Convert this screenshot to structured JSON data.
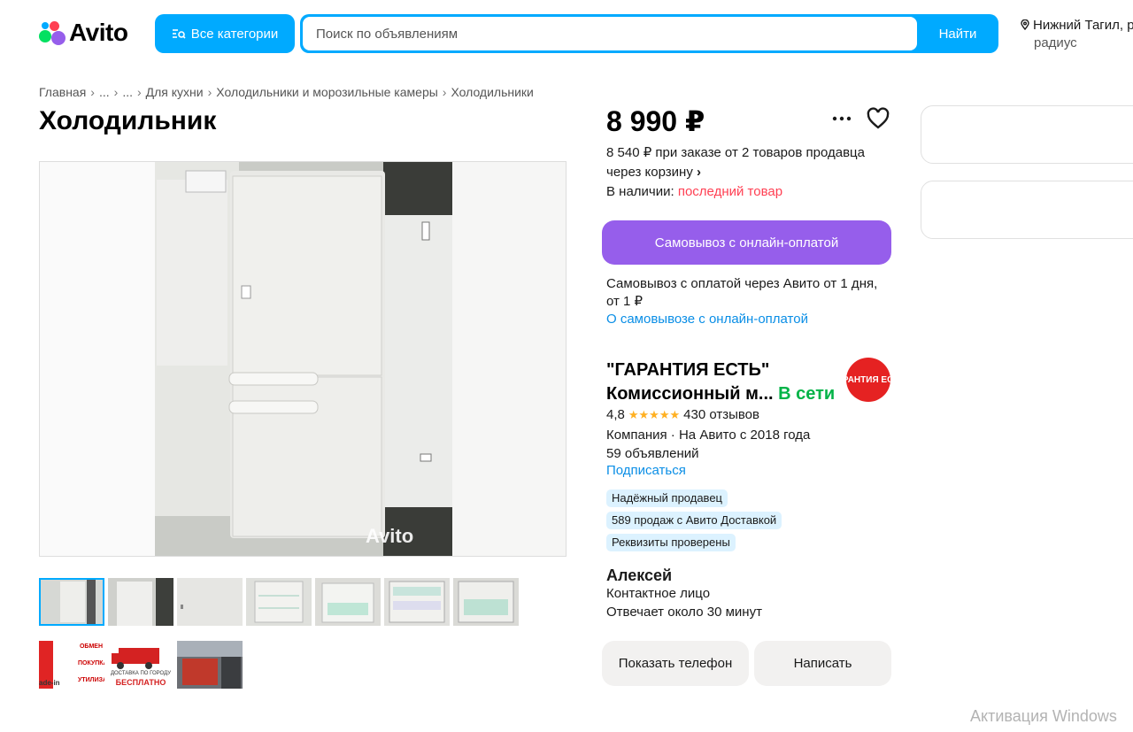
{
  "header": {
    "logo_text": "Avito",
    "categories_label": "Все категории",
    "search_placeholder": "Поиск по объявлениям",
    "search_button": "Найти",
    "location_line1": "Нижний Тагил, р",
    "location_line2": "радиус"
  },
  "breadcrumb": [
    "Главная",
    "...",
    "...",
    "Для кухни",
    "Холодильники и морозильные камеры",
    "Холодильники"
  ],
  "listing": {
    "title": "Холодильник",
    "photo_watermark": "Avito",
    "price": "8 990 ₽",
    "price_alt": "8 540 ₽ при заказе от 2 товаров продавца через корзину",
    "price_alt_arrow": "›",
    "stock_label": "В наличии:",
    "stock_value": "последний товар"
  },
  "pickup": {
    "button": "Самовывоз с онлайн-оплатой",
    "text": "Самовывоз с оплатой через Авито от 1 дня, от 1 ₽",
    "link": "О самовывозе с онлайн-оплатой"
  },
  "seller": {
    "name": "\"ГАРАНТИЯ ЕСТЬ\" Комиссионный м...",
    "online": "В сети",
    "avatar_text": "ГАРАНТИЯ ЕСТЬ",
    "rating": "4,8",
    "stars": "★★★★★",
    "reviews": "430 отзывов",
    "meta_line1": "Компания · На Авито с 2018 года",
    "meta_line2": "59 объявлений",
    "subscribe": "Подписаться",
    "badges": [
      "Надёжный продавец",
      "589 продаж с Авито Доставкой",
      "Реквизиты проверены"
    ]
  },
  "contact": {
    "name": "Алексей",
    "role": "Контактное лицо",
    "response": "Отвечает около 30 минут",
    "phone_button": "Показать телефон",
    "write_button": "Написать"
  },
  "promo_thumbs": {
    "thumb8_lines": [
      "ОБМЕН",
      "ПОКУПКА",
      "УТИЛИЗАЦ"
    ],
    "thumb8_footer": "ade-in",
    "thumb9_lines": [
      "ДОСТАВКА ПО ГОРОДУ",
      "БЕСПЛАТНО"
    ]
  },
  "os_watermark": "Активация Windows",
  "colors": {
    "accent_blue": "#00aaff",
    "purple": "#965eeb",
    "online_green": "#00b347",
    "stock_red": "#ff4053",
    "link_blue": "#0a8ee6"
  },
  "icons": [
    "search-icon",
    "location-pin-icon",
    "more-icon",
    "heart-icon",
    "chevron-right-icon",
    "star-icon"
  ]
}
